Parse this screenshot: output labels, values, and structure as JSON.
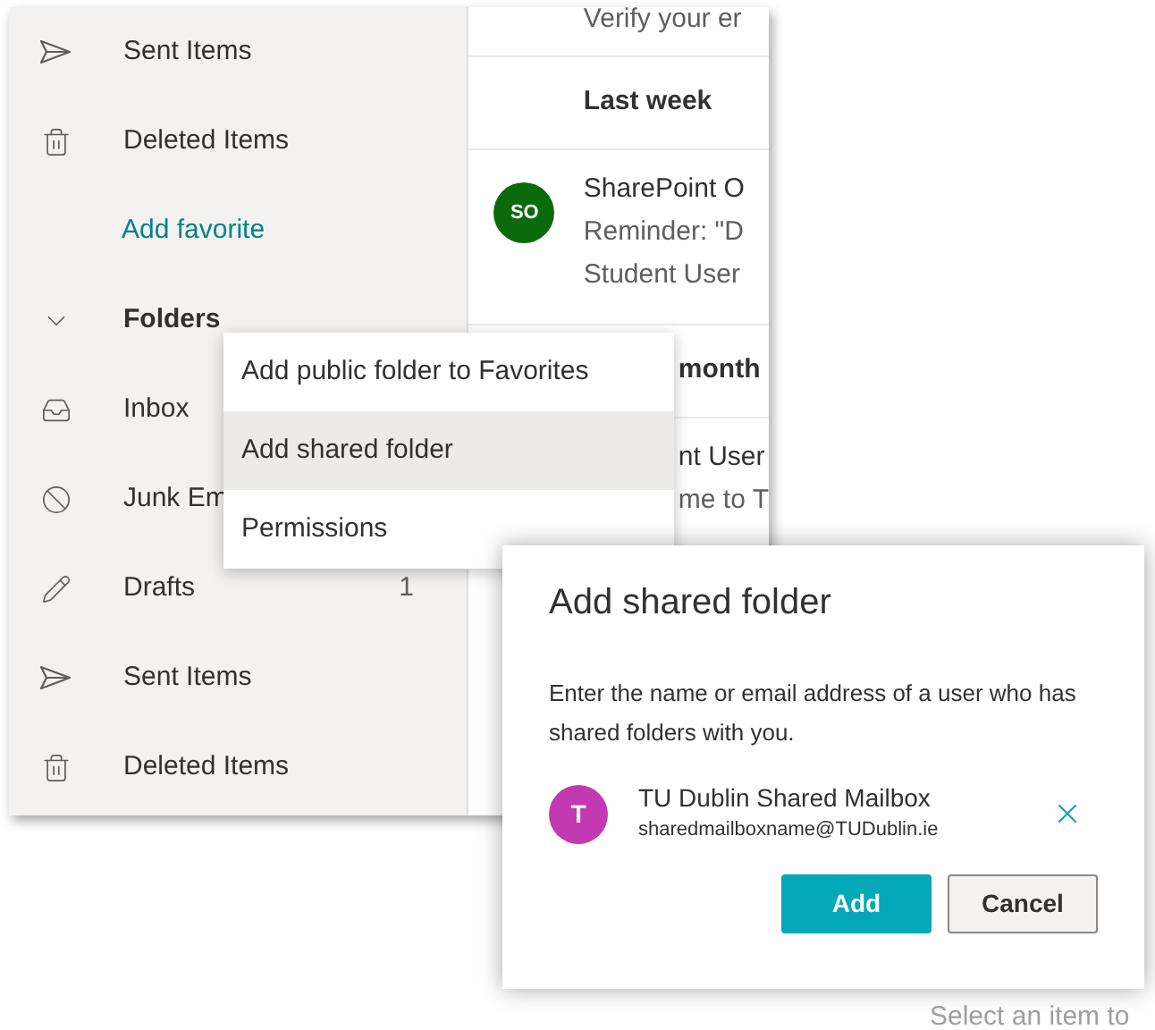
{
  "sidebar": {
    "items": [
      {
        "kind": "sent",
        "label": "Sent Items"
      },
      {
        "kind": "deleted",
        "label": "Deleted Items"
      },
      {
        "kind": "link",
        "label": "Add favorite"
      },
      {
        "kind": "group",
        "label": "Folders",
        "expanded": true
      },
      {
        "kind": "inbox",
        "label": "Inbox"
      },
      {
        "kind": "junk",
        "label": "Junk Em"
      },
      {
        "kind": "drafts",
        "label": "Drafts",
        "count": "1"
      },
      {
        "kind": "sent",
        "label": "Sent Items"
      },
      {
        "kind": "deleted",
        "label": "Deleted Items"
      }
    ]
  },
  "message_list": {
    "items": [
      {
        "kind": "preview",
        "lines": [
          "Verify your er"
        ]
      },
      {
        "kind": "header",
        "label": "Last week"
      },
      {
        "kind": "message",
        "initials": "SO",
        "color": "#0b6a0b",
        "lines": [
          "SharePoint O",
          "Reminder: \"D",
          "Student User"
        ]
      },
      {
        "kind": "header-partial",
        "label": "month"
      },
      {
        "kind": "message-partial",
        "lines": [
          "nt User",
          "me to T"
        ]
      }
    ]
  },
  "context_menu": {
    "items": [
      {
        "label": "Add public folder to Favorites",
        "selected": false
      },
      {
        "label": "Add shared folder",
        "selected": true
      },
      {
        "label": "Permissions",
        "selected": false
      }
    ]
  },
  "dialog": {
    "title": "Add shared folder",
    "description": "Enter the name or email address of a user who has shared folders with you.",
    "person": {
      "initial": "T",
      "color": "#c239b3",
      "name": "TU Dublin Shared Mailbox",
      "email": "sharedmailboxname@TUDublin.ie"
    },
    "buttons": [
      {
        "kind": "primary",
        "label": "Add"
      },
      {
        "kind": "secondary",
        "label": "Cancel"
      }
    ]
  },
  "reading_pane": {
    "hint": "Select an item to"
  }
}
